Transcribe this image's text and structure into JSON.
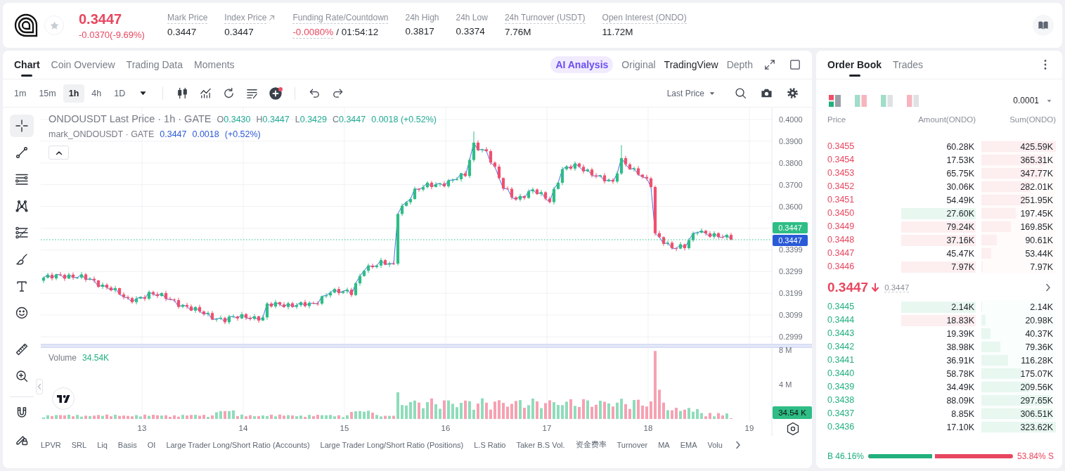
{
  "header": {
    "price": "0.3447",
    "change": "-0.0370(-9.69%)",
    "falling": true,
    "favorite": false,
    "stats": [
      {
        "kind": "plain",
        "label": "Mark Price",
        "value": "0.3447",
        "dotted": true,
        "external": false
      },
      {
        "kind": "plain",
        "label": "Index Price",
        "value": "0.3447",
        "dotted": true,
        "external": true
      },
      {
        "kind": "funding",
        "label": "Funding Rate/Countdown",
        "rate": "-0.0080%",
        "countdown": "/ 01:54:12",
        "dotted": true,
        "external": false
      },
      {
        "kind": "plain",
        "label": "24h High",
        "value": "0.3817",
        "dotted": false,
        "external": false
      },
      {
        "kind": "plain",
        "label": "24h Low",
        "value": "0.3374",
        "dotted": false,
        "external": false
      },
      {
        "kind": "plain",
        "label": "24h Turnover (USDT)",
        "value": "7.76M",
        "dotted": true,
        "external": false
      },
      {
        "kind": "plain",
        "label": "Open Interest (ONDO)",
        "value": "11.72M",
        "dotted": true,
        "external": false
      }
    ]
  },
  "chart_panel": {
    "tabs": [
      {
        "label": "Chart",
        "selected": true
      },
      {
        "label": "Coin Overview",
        "selected": false
      },
      {
        "label": "Trading Data",
        "selected": false
      },
      {
        "label": "Moments",
        "selected": false
      }
    ],
    "views": [
      {
        "kind": "ai",
        "label": "AI Analysis",
        "selected": false
      },
      {
        "kind": "text",
        "label": "Original",
        "selected": false
      },
      {
        "kind": "text",
        "label": "TradingView",
        "selected": true
      },
      {
        "kind": "text",
        "label": "Depth",
        "selected": false
      }
    ],
    "intervals": [
      {
        "label": "1m",
        "selected": false
      },
      {
        "label": "15m",
        "selected": false
      },
      {
        "label": "1h",
        "selected": true
      },
      {
        "label": "4h",
        "selected": false
      },
      {
        "label": "1D",
        "selected": false
      }
    ],
    "add_indicator_alert": true,
    "price_source": "Last Price",
    "drawing_tools": [
      {
        "kind": "crosshair",
        "selected": true
      },
      {
        "kind": "trend_line",
        "selected": false
      },
      {
        "kind": "fib_lines",
        "selected": false
      },
      {
        "kind": "pattern",
        "selected": false
      },
      {
        "kind": "projection",
        "selected": false
      },
      {
        "kind": "brush",
        "selected": false
      },
      {
        "kind": "text",
        "selected": false
      },
      {
        "kind": "emoji",
        "selected": false
      },
      {
        "kind": "ruler",
        "selected": false
      },
      {
        "kind": "zoom",
        "selected": false
      },
      {
        "kind": "magnet",
        "selected": false
      },
      {
        "kind": "lock",
        "selected": false
      }
    ],
    "legend": {
      "title": "ONDOUSDT Last Price · 1h · GATE",
      "rising": true,
      "ohlc": [
        {
          "key": "O",
          "value": "0.3430"
        },
        {
          "key": "H",
          "value": "0.3447"
        },
        {
          "key": "L",
          "value": "0.3429"
        },
        {
          "key": "C",
          "value": "0.3447"
        }
      ],
      "change": "0.0018 (+0.52%)"
    },
    "mark_legend": {
      "title": "mark_ONDOUSDT · GATE",
      "price": "0.3447",
      "change": "0.0018",
      "percent": "(+0.52%)"
    },
    "price_axis": [
      "0.4000",
      "0.3900",
      "0.3800",
      "0.3700",
      "0.3600",
      "0.3399",
      "0.3299",
      "0.3199",
      "0.3099",
      "0.2999"
    ],
    "last_price_badge": "0.3447",
    "mark_price_badge": "0.3447",
    "volume_legend": {
      "label": "Volume",
      "value": "34.54K"
    },
    "volume_axis": [
      "8 M",
      "4 M"
    ],
    "volume_badge": "34.54 K",
    "time_axis": [
      "13",
      "14",
      "15",
      "16",
      "17",
      "18",
      "19"
    ],
    "indicators": [
      "LPVR",
      "SRL",
      "Liq",
      "Basis",
      "OI",
      "Large Trader Long/Short Ratio (Accounts)",
      "Large Trader Long/Short Ratio (Positions)",
      "L.S Ratio",
      "Taker B.S Vol.",
      "资金费率",
      "Turnover",
      "MA",
      "EMA",
      "Volu"
    ]
  },
  "order_book": {
    "tabs": [
      {
        "label": "Order Book",
        "selected": true
      },
      {
        "label": "Trades",
        "selected": false
      }
    ],
    "layouts": [
      {
        "kind": "both",
        "selected": true
      },
      {
        "kind": "split",
        "selected": false
      },
      {
        "kind": "bids",
        "selected": false
      },
      {
        "kind": "asks",
        "selected": false
      }
    ],
    "precision": "0.0001",
    "columns": [
      "Price",
      "Amount(ONDO)",
      "Sum(ONDO)"
    ],
    "asks": [
      {
        "price": "0.3455",
        "amount": "60.28K",
        "sum": "425.59K",
        "level": 1.0,
        "flash_up": false,
        "flash_down": false
      },
      {
        "price": "0.3454",
        "amount": "17.53K",
        "sum": "365.31K",
        "level": 0.86,
        "flash_up": false,
        "flash_down": false
      },
      {
        "price": "0.3453",
        "amount": "65.75K",
        "sum": "347.77K",
        "level": 0.82,
        "flash_up": false,
        "flash_down": false
      },
      {
        "price": "0.3452",
        "amount": "30.06K",
        "sum": "282.01K",
        "level": 0.66,
        "flash_up": false,
        "flash_down": false
      },
      {
        "price": "0.3451",
        "amount": "54.49K",
        "sum": "251.95K",
        "level": 0.59,
        "flash_up": false,
        "flash_down": false
      },
      {
        "price": "0.3450",
        "amount": "27.60K",
        "sum": "197.45K",
        "level": 0.46,
        "flash_up": true,
        "flash_down": false
      },
      {
        "price": "0.3449",
        "amount": "79.24K",
        "sum": "169.85K",
        "level": 0.4,
        "flash_up": false,
        "flash_down": true
      },
      {
        "price": "0.3448",
        "amount": "37.16K",
        "sum": "90.61K",
        "level": 0.21,
        "flash_up": false,
        "flash_down": true
      },
      {
        "price": "0.3447",
        "amount": "45.47K",
        "sum": "53.44K",
        "level": 0.13,
        "flash_up": false,
        "flash_down": false
      },
      {
        "price": "0.3446",
        "amount": "7.97K",
        "sum": "7.97K",
        "level": 0.02,
        "flash_up": false,
        "flash_down": true
      }
    ],
    "last_price": "0.3447",
    "falling": true,
    "mark_price": "0.3447",
    "bids": [
      {
        "price": "0.3445",
        "amount": "2.14K",
        "sum": "2.14K",
        "level": 0.01,
        "flash_up": true,
        "flash_down": false
      },
      {
        "price": "0.3444",
        "amount": "18.83K",
        "sum": "20.98K",
        "level": 0.06,
        "flash_up": false,
        "flash_down": true
      },
      {
        "price": "0.3443",
        "amount": "19.39K",
        "sum": "40.37K",
        "level": 0.12,
        "flash_up": false,
        "flash_down": false
      },
      {
        "price": "0.3442",
        "amount": "38.98K",
        "sum": "79.36K",
        "level": 0.25,
        "flash_up": false,
        "flash_down": false
      },
      {
        "price": "0.3441",
        "amount": "36.91K",
        "sum": "116.28K",
        "level": 0.36,
        "flash_up": false,
        "flash_down": false
      },
      {
        "price": "0.3440",
        "amount": "58.78K",
        "sum": "175.07K",
        "level": 0.54,
        "flash_up": false,
        "flash_down": false
      },
      {
        "price": "0.3439",
        "amount": "34.49K",
        "sum": "209.56K",
        "level": 0.65,
        "flash_up": false,
        "flash_down": false
      },
      {
        "price": "0.3438",
        "amount": "88.09K",
        "sum": "297.65K",
        "level": 0.92,
        "flash_up": false,
        "flash_down": false
      },
      {
        "price": "0.3437",
        "amount": "8.85K",
        "sum": "306.51K",
        "level": 0.95,
        "flash_up": false,
        "flash_down": false
      },
      {
        "price": "0.3436",
        "amount": "17.10K",
        "sum": "323.62K",
        "level": 1.0,
        "flash_up": false,
        "flash_down": false
      }
    ],
    "ratio": {
      "buy": "B 46.16%",
      "sell": "53.84% S",
      "level": 0.4616
    }
  }
}
